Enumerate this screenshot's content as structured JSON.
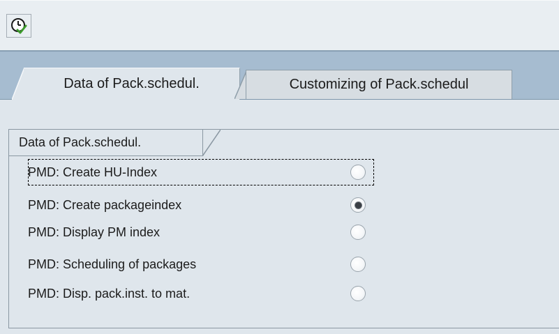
{
  "toolbar": {
    "execute_icon": "execute-clock-check-icon",
    "colors": {
      "check": "#3c9a2c",
      "clock": "#1a1a1a"
    }
  },
  "tabs": [
    {
      "label": "Data of Pack.schedul.",
      "active": true
    },
    {
      "label": "Customizing of Pack.schedul",
      "active": false
    }
  ],
  "group": {
    "title": "Data of Pack.schedul.",
    "options": [
      {
        "label": "PMD: Create HU-Index",
        "selected": false,
        "focused": true
      },
      {
        "label": "PMD: Create packageindex",
        "selected": true,
        "focused": false
      },
      {
        "label": "PMD: Display PM index",
        "selected": false,
        "focused": false
      },
      {
        "label": "PMD: Scheduling of packages",
        "selected": false,
        "focused": false
      },
      {
        "label": "PMD: Disp. pack.inst. to mat.",
        "selected": false,
        "focused": false
      }
    ]
  },
  "theme": {
    "tab_band": "#a6bcd0",
    "background": "#dfe6ec",
    "border": "#8a97a2"
  }
}
